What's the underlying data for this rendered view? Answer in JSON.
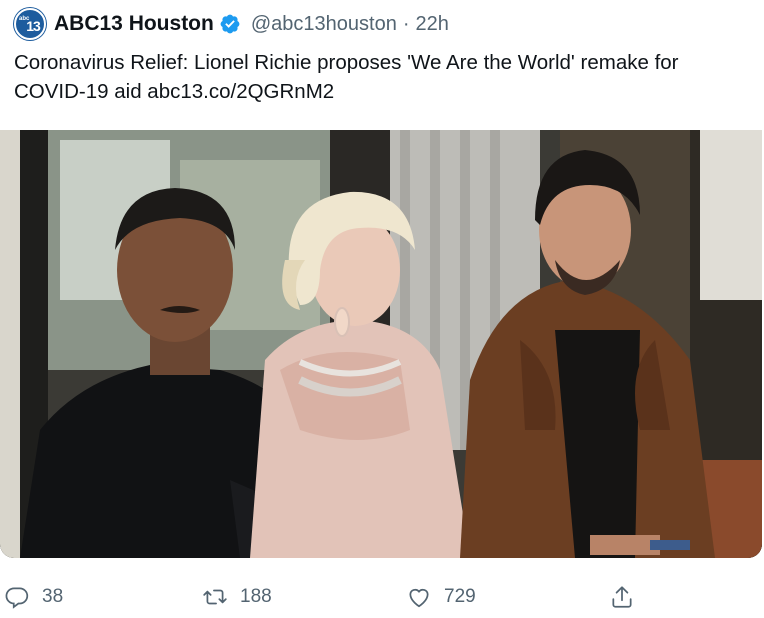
{
  "tweet": {
    "avatar_label": "abc",
    "avatar_number": "13",
    "author_name": "ABC13 Houston",
    "handle": "@abc13houston",
    "separator": "·",
    "time": "22h",
    "text": "Coronavirus Relief: Lionel Richie proposes 'We Are the World' remake for COVID-19 aid abc13.co/2QGRnM2"
  },
  "actions": {
    "replies": "38",
    "retweets": "188",
    "likes": "729"
  },
  "icons": {
    "verified": "verified-badge-icon",
    "reply": "reply-icon",
    "retweet": "retweet-icon",
    "like": "heart-icon",
    "share": "share-icon"
  },
  "colors": {
    "verified_blue": "#1d9bf0",
    "secondary_text": "#536471",
    "brand_blue": "#1d5c9e"
  }
}
